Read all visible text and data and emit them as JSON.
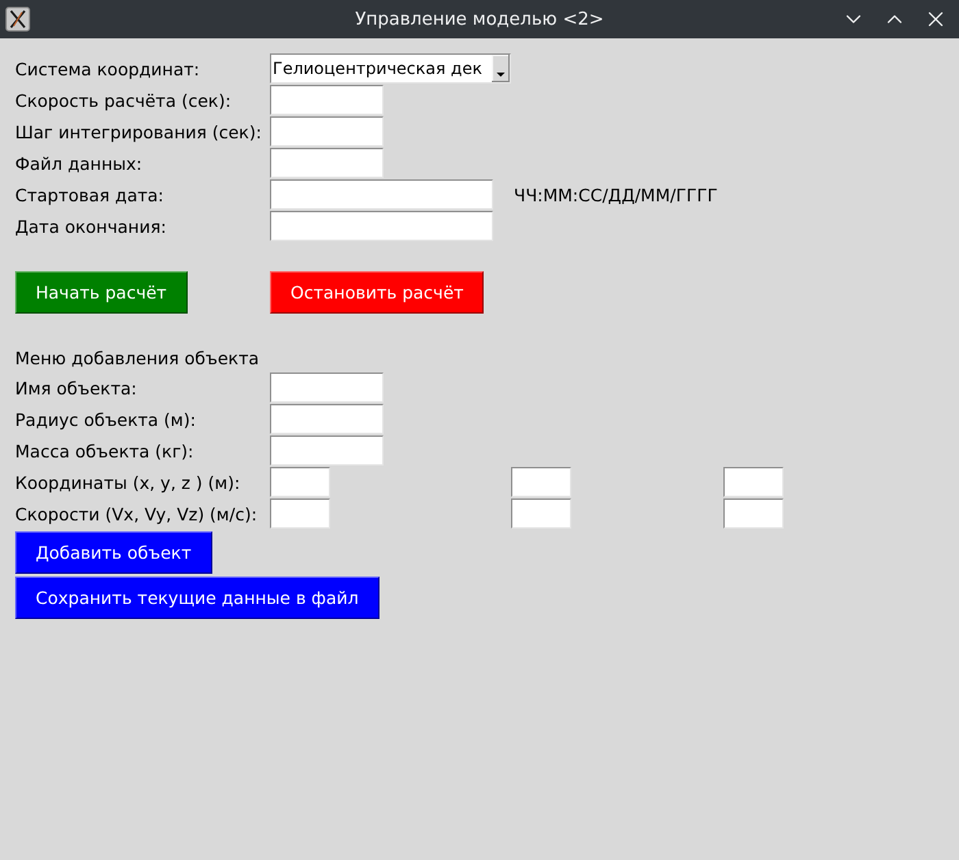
{
  "window": {
    "title": "Управление моделью <2>"
  },
  "settings": {
    "fields": [
      {
        "kind": "combobox",
        "label": "Система координат:",
        "value": "Гелиоцентрическая дек"
      },
      {
        "kind": "entry",
        "label": "Скорость расчёта (сек):"
      },
      {
        "kind": "entry",
        "label": "Шаг интегрирования (сек):"
      },
      {
        "kind": "entry",
        "label": "Файл данных:"
      },
      {
        "kind": "date",
        "label": "Стартовая дата:",
        "hint": "ЧЧ:ММ:СС/ДД/ММ/ГГГГ"
      },
      {
        "kind": "date",
        "label": "Дата окончания:"
      }
    ]
  },
  "controls": [
    {
      "label": "Начать расчёт",
      "color": "#008000"
    },
    {
      "label": "Остановить расчёт",
      "color": "#ff0000"
    }
  ],
  "add_object": {
    "title": "Меню добавления объекта",
    "fields": [
      {
        "kind": "entry",
        "label": "Имя объекта:"
      },
      {
        "kind": "entry",
        "label": "Радиус объекта (м):"
      },
      {
        "kind": "entry",
        "label": "Масса объекта (кг):"
      },
      {
        "kind": "vector",
        "label": "Координаты (x, y, z ) (м):"
      },
      {
        "kind": "vector",
        "label": "Скорости (Vx, Vy, Vz) (м/с):"
      }
    ],
    "buttons": [
      "Добавить объект",
      "Сохранить текущие данные в файл"
    ]
  }
}
